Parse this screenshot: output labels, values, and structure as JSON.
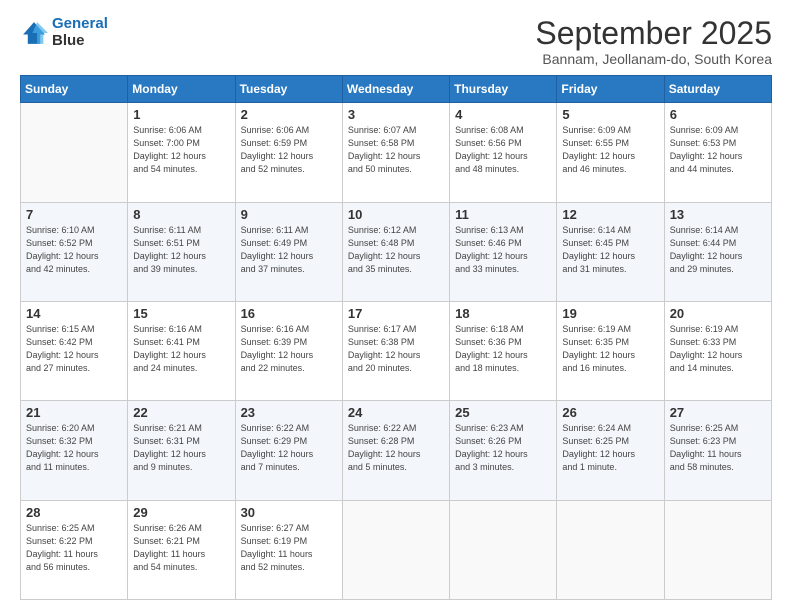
{
  "header": {
    "logo_line1": "General",
    "logo_line2": "Blue",
    "month": "September 2025",
    "location": "Bannam, Jeollanam-do, South Korea"
  },
  "days_of_week": [
    "Sunday",
    "Monday",
    "Tuesday",
    "Wednesday",
    "Thursday",
    "Friday",
    "Saturday"
  ],
  "weeks": [
    [
      {
        "day": "",
        "info": ""
      },
      {
        "day": "1",
        "info": "Sunrise: 6:06 AM\nSunset: 7:00 PM\nDaylight: 12 hours\nand 54 minutes."
      },
      {
        "day": "2",
        "info": "Sunrise: 6:06 AM\nSunset: 6:59 PM\nDaylight: 12 hours\nand 52 minutes."
      },
      {
        "day": "3",
        "info": "Sunrise: 6:07 AM\nSunset: 6:58 PM\nDaylight: 12 hours\nand 50 minutes."
      },
      {
        "day": "4",
        "info": "Sunrise: 6:08 AM\nSunset: 6:56 PM\nDaylight: 12 hours\nand 48 minutes."
      },
      {
        "day": "5",
        "info": "Sunrise: 6:09 AM\nSunset: 6:55 PM\nDaylight: 12 hours\nand 46 minutes."
      },
      {
        "day": "6",
        "info": "Sunrise: 6:09 AM\nSunset: 6:53 PM\nDaylight: 12 hours\nand 44 minutes."
      }
    ],
    [
      {
        "day": "7",
        "info": "Sunrise: 6:10 AM\nSunset: 6:52 PM\nDaylight: 12 hours\nand 42 minutes."
      },
      {
        "day": "8",
        "info": "Sunrise: 6:11 AM\nSunset: 6:51 PM\nDaylight: 12 hours\nand 39 minutes."
      },
      {
        "day": "9",
        "info": "Sunrise: 6:11 AM\nSunset: 6:49 PM\nDaylight: 12 hours\nand 37 minutes."
      },
      {
        "day": "10",
        "info": "Sunrise: 6:12 AM\nSunset: 6:48 PM\nDaylight: 12 hours\nand 35 minutes."
      },
      {
        "day": "11",
        "info": "Sunrise: 6:13 AM\nSunset: 6:46 PM\nDaylight: 12 hours\nand 33 minutes."
      },
      {
        "day": "12",
        "info": "Sunrise: 6:14 AM\nSunset: 6:45 PM\nDaylight: 12 hours\nand 31 minutes."
      },
      {
        "day": "13",
        "info": "Sunrise: 6:14 AM\nSunset: 6:44 PM\nDaylight: 12 hours\nand 29 minutes."
      }
    ],
    [
      {
        "day": "14",
        "info": "Sunrise: 6:15 AM\nSunset: 6:42 PM\nDaylight: 12 hours\nand 27 minutes."
      },
      {
        "day": "15",
        "info": "Sunrise: 6:16 AM\nSunset: 6:41 PM\nDaylight: 12 hours\nand 24 minutes."
      },
      {
        "day": "16",
        "info": "Sunrise: 6:16 AM\nSunset: 6:39 PM\nDaylight: 12 hours\nand 22 minutes."
      },
      {
        "day": "17",
        "info": "Sunrise: 6:17 AM\nSunset: 6:38 PM\nDaylight: 12 hours\nand 20 minutes."
      },
      {
        "day": "18",
        "info": "Sunrise: 6:18 AM\nSunset: 6:36 PM\nDaylight: 12 hours\nand 18 minutes."
      },
      {
        "day": "19",
        "info": "Sunrise: 6:19 AM\nSunset: 6:35 PM\nDaylight: 12 hours\nand 16 minutes."
      },
      {
        "day": "20",
        "info": "Sunrise: 6:19 AM\nSunset: 6:33 PM\nDaylight: 12 hours\nand 14 minutes."
      }
    ],
    [
      {
        "day": "21",
        "info": "Sunrise: 6:20 AM\nSunset: 6:32 PM\nDaylight: 12 hours\nand 11 minutes."
      },
      {
        "day": "22",
        "info": "Sunrise: 6:21 AM\nSunset: 6:31 PM\nDaylight: 12 hours\nand 9 minutes."
      },
      {
        "day": "23",
        "info": "Sunrise: 6:22 AM\nSunset: 6:29 PM\nDaylight: 12 hours\nand 7 minutes."
      },
      {
        "day": "24",
        "info": "Sunrise: 6:22 AM\nSunset: 6:28 PM\nDaylight: 12 hours\nand 5 minutes."
      },
      {
        "day": "25",
        "info": "Sunrise: 6:23 AM\nSunset: 6:26 PM\nDaylight: 12 hours\nand 3 minutes."
      },
      {
        "day": "26",
        "info": "Sunrise: 6:24 AM\nSunset: 6:25 PM\nDaylight: 12 hours\nand 1 minute."
      },
      {
        "day": "27",
        "info": "Sunrise: 6:25 AM\nSunset: 6:23 PM\nDaylight: 11 hours\nand 58 minutes."
      }
    ],
    [
      {
        "day": "28",
        "info": "Sunrise: 6:25 AM\nSunset: 6:22 PM\nDaylight: 11 hours\nand 56 minutes."
      },
      {
        "day": "29",
        "info": "Sunrise: 6:26 AM\nSunset: 6:21 PM\nDaylight: 11 hours\nand 54 minutes."
      },
      {
        "day": "30",
        "info": "Sunrise: 6:27 AM\nSunset: 6:19 PM\nDaylight: 11 hours\nand 52 minutes."
      },
      {
        "day": "",
        "info": ""
      },
      {
        "day": "",
        "info": ""
      },
      {
        "day": "",
        "info": ""
      },
      {
        "day": "",
        "info": ""
      }
    ]
  ]
}
